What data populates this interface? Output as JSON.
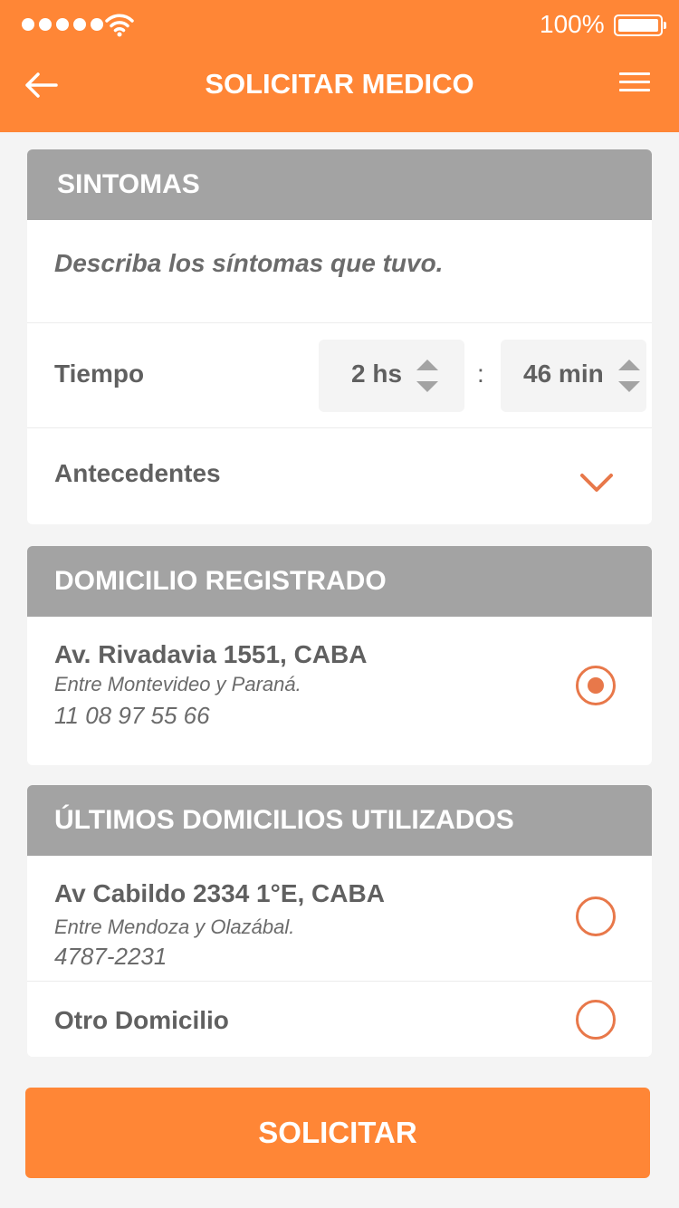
{
  "status_bar": {
    "battery": "100%"
  },
  "header": {
    "title": "SOLICITAR MEDICO"
  },
  "sintomas": {
    "heading": "SINTOMAS",
    "placeholder": "Describa los síntomas que tuvo.",
    "tiempo_label": "Tiempo",
    "hours": "2 hs",
    "separator": ":",
    "minutes": "46 min",
    "antecedentes_label": "Antecedentes"
  },
  "domicilio_registrado": {
    "heading": "DOMICILIO REGISTRADO",
    "address": "Av. Rivadavia 1551, CABA",
    "between": "Entre Montevideo y Paraná.",
    "phone": "11 08 97 55 66",
    "selected": true
  },
  "ultimos_domicilios": {
    "heading": "ÚLTIMOS DOMICILIOS UTILIZADOS",
    "items": [
      {
        "address": "Av Cabildo 2334 1°E, CABA",
        "between": "Entre Mendoza y Olazábal.",
        "phone": "4787-2231",
        "selected": false
      },
      {
        "address": "Otro Domicilio",
        "selected": false
      }
    ]
  },
  "submit_label": "SOLICITAR",
  "colors": {
    "accent": "#ff8636",
    "section_header": "#a3a3a3",
    "radio": "#e8784a"
  },
  "icons": [
    "back-arrow-icon",
    "hamburger-menu-icon",
    "wifi-icon",
    "battery-icon",
    "chevron-down-icon",
    "stepper-arrows-icon"
  ]
}
